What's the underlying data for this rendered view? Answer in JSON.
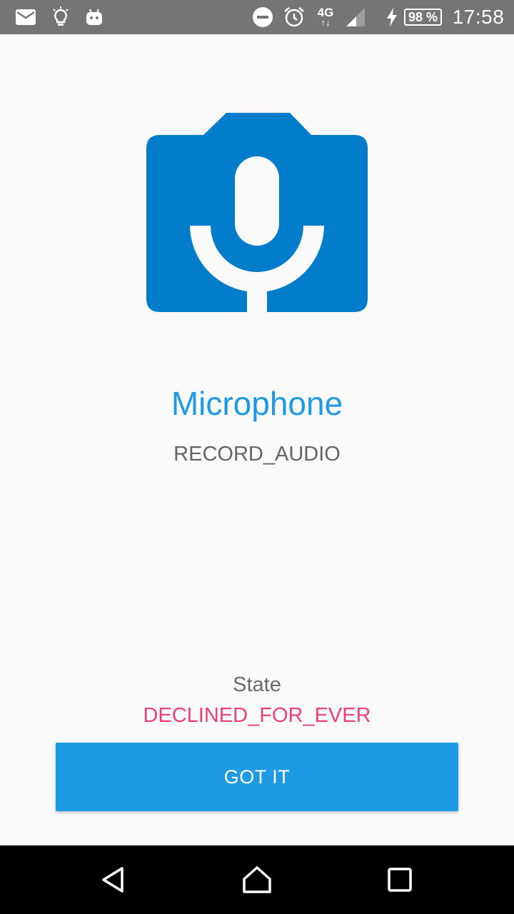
{
  "status_bar": {
    "icons": [
      "mail-icon",
      "lightbulb-icon",
      "android-icon",
      "do-not-disturb-icon",
      "alarm-icon",
      "network-4g-icon",
      "signal-icon",
      "charging-icon",
      "battery-icon"
    ],
    "network_type": "4G",
    "network_arrows": "↑↓",
    "battery_percent": "98 %",
    "time": "17:58"
  },
  "permission": {
    "icon": "camera-microphone-icon",
    "title": "Microphone",
    "name": "RECORD_AUDIO"
  },
  "state": {
    "label": "State",
    "value": "DECLINED_FOR_EVER"
  },
  "actions": {
    "confirm_label": "GOT IT"
  },
  "navigation_bar": {
    "buttons": [
      "back-icon",
      "home-icon",
      "recents-icon"
    ]
  },
  "colors": {
    "accent": "#1e9ae4",
    "icon_blue": "#007ccb",
    "declined": "#ec407a",
    "status_bar": "#757575",
    "background": "#fafafa"
  }
}
